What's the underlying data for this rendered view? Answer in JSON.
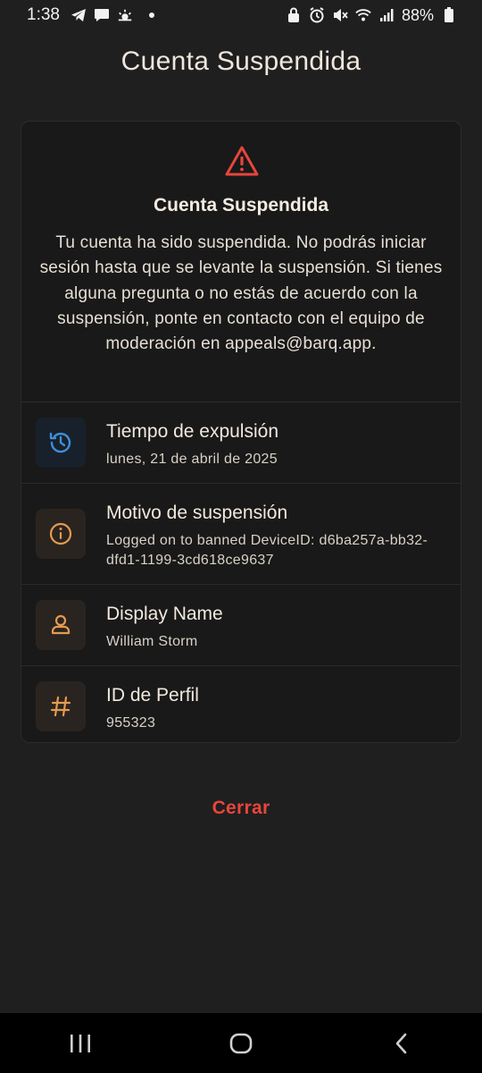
{
  "status_bar": {
    "time": "1:38",
    "battery": "88%",
    "icons": [
      "telegram-icon",
      "message-icon",
      "weather-icon",
      "notification-dot",
      "lock-icon",
      "alarm-icon",
      "mute-icon",
      "wifi-icon",
      "signal-icon",
      "battery-icon"
    ]
  },
  "header": {
    "title": "Cuenta Suspendida"
  },
  "card": {
    "icon": "warning-icon",
    "title": "Cuenta Suspendida",
    "description": "Tu cuenta ha sido suspendida. No podrás iniciar sesión hasta que se levante la suspensión. Si tienes alguna pregunta o no estás de acuerdo con la suspensión, ponte en contacto con el equipo de moderación en appeals@barq.app.",
    "rows": [
      {
        "icon": "history-icon",
        "label": "Tiempo de expulsión",
        "value": "lunes, 21 de abril de 2025",
        "icon_color": "#3f8ed8",
        "icon_bg": "#18212b"
      },
      {
        "icon": "info-icon",
        "label": "Motivo de suspensión",
        "value": "Logged on to banned DeviceID: d6ba257a-bb32-dfd1-1199-3cd618ce9637",
        "icon_color": "#e59a52",
        "icon_bg": "#2a2420"
      },
      {
        "icon": "user-icon",
        "label": "Display Name",
        "value": "William Storm",
        "icon_color": "#e59a52",
        "icon_bg": "#2a2420"
      },
      {
        "icon": "hash-icon",
        "label": "ID de Perfil",
        "value": "955323",
        "icon_color": "#e59a52",
        "icon_bg": "#2a2420"
      }
    ]
  },
  "actions": {
    "close_label": "Cerrar"
  },
  "colors": {
    "background": "#1f1f1f",
    "card": "#191919",
    "danger": "#e8453c",
    "accent_orange": "#e59a52",
    "accent_blue": "#3f8ed8"
  },
  "nav_bar": {
    "buttons": [
      "recent-apps-icon",
      "home-icon",
      "back-icon"
    ]
  }
}
